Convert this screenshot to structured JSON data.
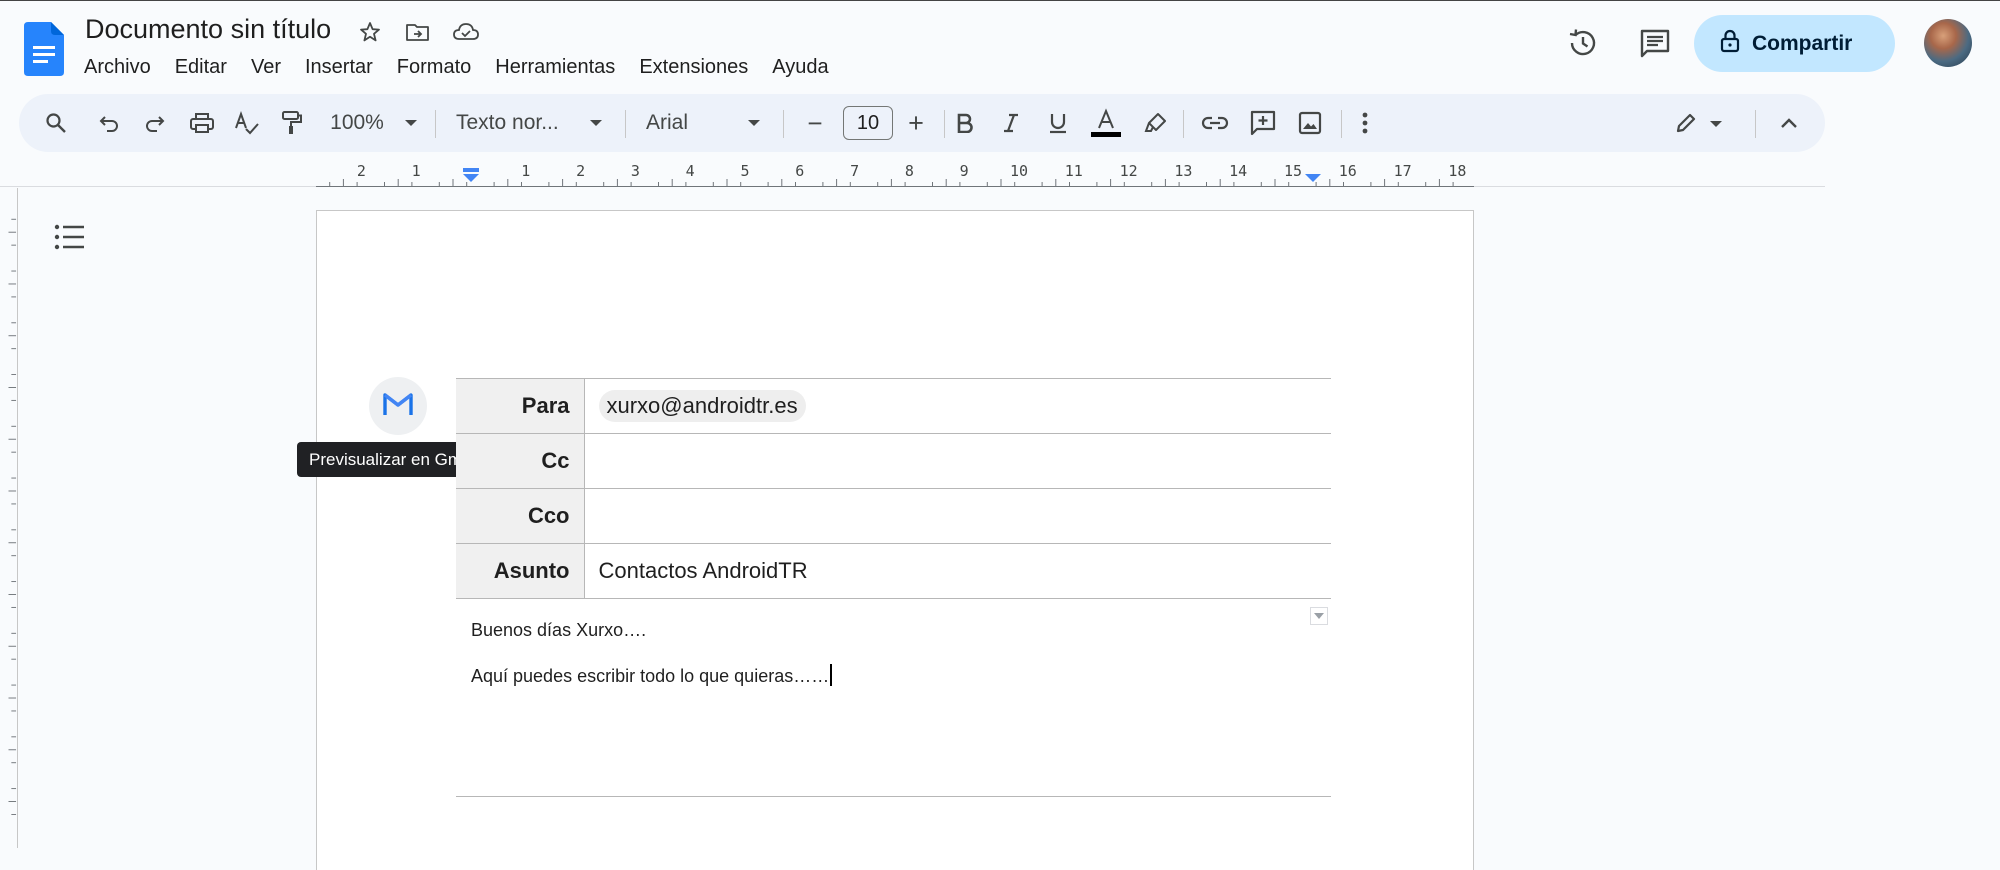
{
  "document": {
    "title": "Documento sin título"
  },
  "menu": [
    "Archivo",
    "Editar",
    "Ver",
    "Insertar",
    "Formato",
    "Herramientas",
    "Extensiones",
    "Ayuda"
  ],
  "header": {
    "share_label": "Compartir"
  },
  "toolbar": {
    "zoom": "100%",
    "style": "Texto nor...",
    "font": "Arial",
    "font_size": "10",
    "minus": "−",
    "plus": "+"
  },
  "ruler": {
    "left_labels": [
      "2",
      "1"
    ],
    "right_labels": [
      "1",
      "2",
      "3",
      "4",
      "5",
      "6",
      "7",
      "8",
      "9",
      "10",
      "11",
      "12",
      "13",
      "14",
      "15",
      "16",
      "17",
      "18"
    ]
  },
  "email": {
    "tooltip": "Previsualizar en Gmail",
    "to_label": "Para",
    "to_value": "xurxo@androidtr.es",
    "cc_label": "Cc",
    "bcc_label": "Cco",
    "subject_label": "Asunto",
    "subject_value": "Contactos AndroidTR",
    "body_line1": "Buenos días Xurxo….",
    "body_line2": "Aquí puedes escribir todo lo que quieras……"
  },
  "colors": {
    "accent": "#1a73e8",
    "share_bg": "#c2e7ff",
    "toolbar_bg": "#edf2fa"
  },
  "icons": [
    "docs-logo-icon",
    "star-icon",
    "move-folder-icon",
    "cloud-saved-icon",
    "version-history-icon",
    "comments-icon",
    "lock-icon",
    "search-icon",
    "undo-icon",
    "redo-icon",
    "print-icon",
    "spellcheck-icon",
    "paint-format-icon",
    "bold-icon",
    "italic-icon",
    "underline-icon",
    "text-color-icon",
    "highlight-icon",
    "link-icon",
    "add-comment-icon",
    "insert-image-icon",
    "more-vert-icon",
    "edit-mode-icon",
    "collapse-icon",
    "outline-icon",
    "gmail-icon"
  ]
}
